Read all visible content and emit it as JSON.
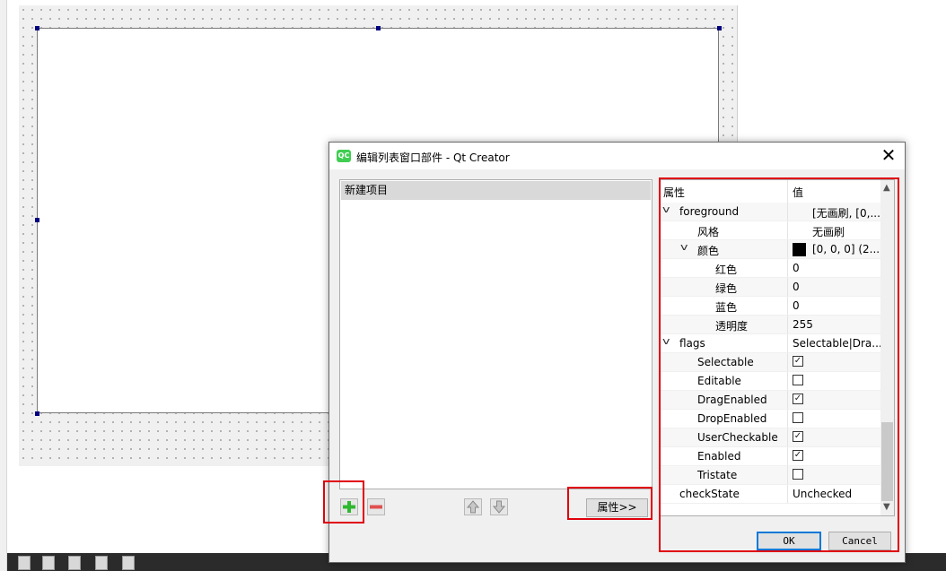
{
  "dialog": {
    "title": "编辑列表窗口部件 - Qt Creator",
    "app_icon": "QC",
    "close_glyph": "✕"
  },
  "item_list": {
    "items": [
      "新建项目"
    ]
  },
  "list_buttons": {
    "add_icon": "plus-icon",
    "remove_icon": "minus-icon",
    "up_icon": "arrow-up-icon",
    "down_icon": "arrow-down-icon",
    "properties_label": "属性>>"
  },
  "property_editor": {
    "header": {
      "name": "属性",
      "value": "值"
    },
    "rows": [
      {
        "name": "foreground",
        "value": "[无画刷, [0,..."
      },
      {
        "name": "风格",
        "value": "无画刷"
      },
      {
        "name": "颜色",
        "value": "[0, 0, 0] (2..."
      },
      {
        "name": "红色",
        "value": "0"
      },
      {
        "name": "绿色",
        "value": "0"
      },
      {
        "name": "蓝色",
        "value": "0"
      },
      {
        "name": "透明度",
        "value": "255"
      },
      {
        "name": "flags",
        "value": "Selectable|Dra..."
      },
      {
        "name": "Selectable",
        "checked": true
      },
      {
        "name": "Editable",
        "checked": false
      },
      {
        "name": "DragEnabled",
        "checked": true
      },
      {
        "name": "DropEnabled",
        "checked": false
      },
      {
        "name": "UserCheckable",
        "checked": true
      },
      {
        "name": "Enabled",
        "checked": true
      },
      {
        "name": "Tristate",
        "checked": false
      },
      {
        "name": "checkState",
        "value": "Unchecked"
      }
    ],
    "color_swatch": "#000000"
  },
  "footer": {
    "ok_label": "OK",
    "cancel_label": "Cancel"
  },
  "colors": {
    "highlight_box": "#e0000c",
    "selection_handle": "#000080"
  }
}
